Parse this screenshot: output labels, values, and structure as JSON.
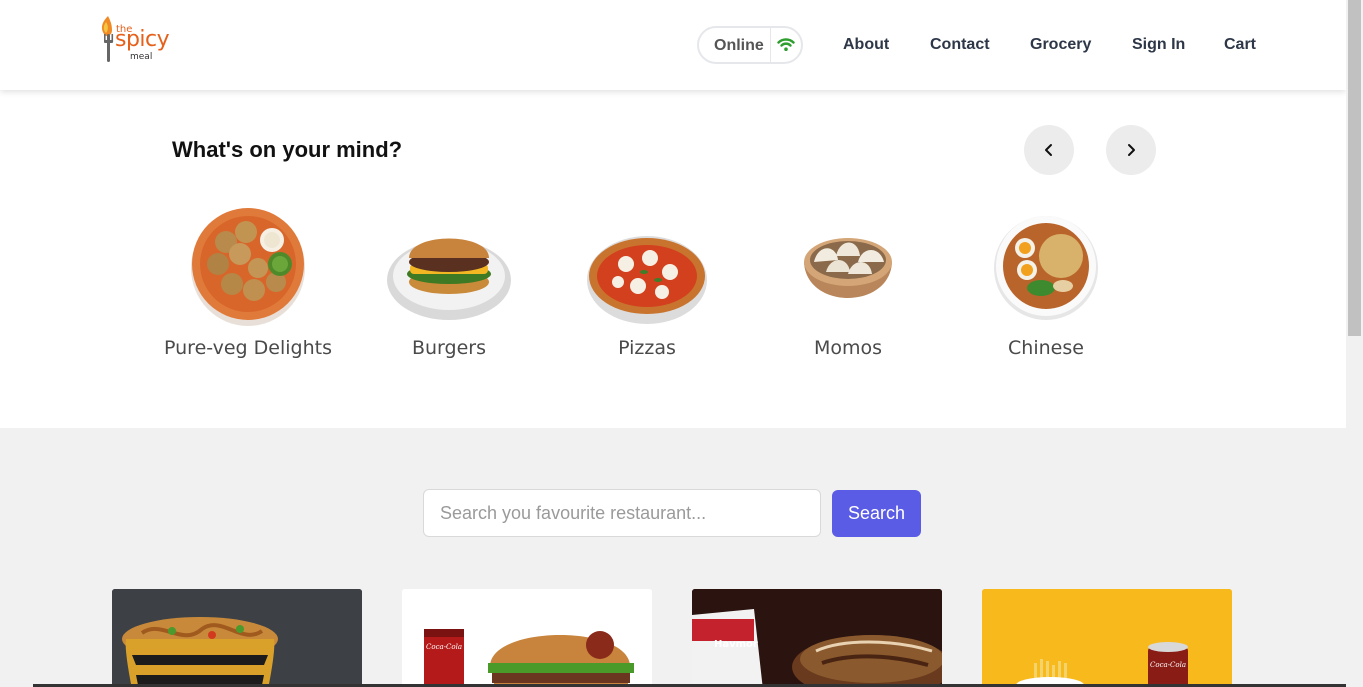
{
  "header": {
    "logo": {
      "line1": "the",
      "line2": "spicy",
      "line3": "meal"
    },
    "status": {
      "label": "Online",
      "icon": "wifi-icon",
      "icon_color": "#2e9e2e"
    },
    "nav": [
      {
        "label": "About"
      },
      {
        "label": "Contact"
      },
      {
        "label": "Grocery"
      },
      {
        "label": "Sign In"
      },
      {
        "label": "Cart"
      }
    ]
  },
  "mind": {
    "title": "What's on your mind?",
    "prev_icon": "chevron-left-icon",
    "next_icon": "chevron-right-icon",
    "categories": [
      {
        "label": "Pure-veg Delights",
        "icon": "pure-veg-dish-image"
      },
      {
        "label": "Burgers",
        "icon": "burger-image"
      },
      {
        "label": "Pizzas",
        "icon": "pizza-image"
      },
      {
        "label": "Momos",
        "icon": "momos-image"
      },
      {
        "label": "Chinese",
        "icon": "noodles-image"
      }
    ]
  },
  "search": {
    "placeholder": "Search you favourite restaurant...",
    "value": "",
    "button_label": "Search",
    "button_color": "#5b5ce6"
  },
  "restaurant_cards": [
    {
      "image": "noodles-bowl-photo"
    },
    {
      "image": "burger-cola-photo"
    },
    {
      "image": "ice-cream-cake-photo"
    },
    {
      "image": "fries-cola-yellow-photo"
    }
  ],
  "card_logos": {
    "cola": "Coca-Cola",
    "havmor": "Havmor"
  }
}
